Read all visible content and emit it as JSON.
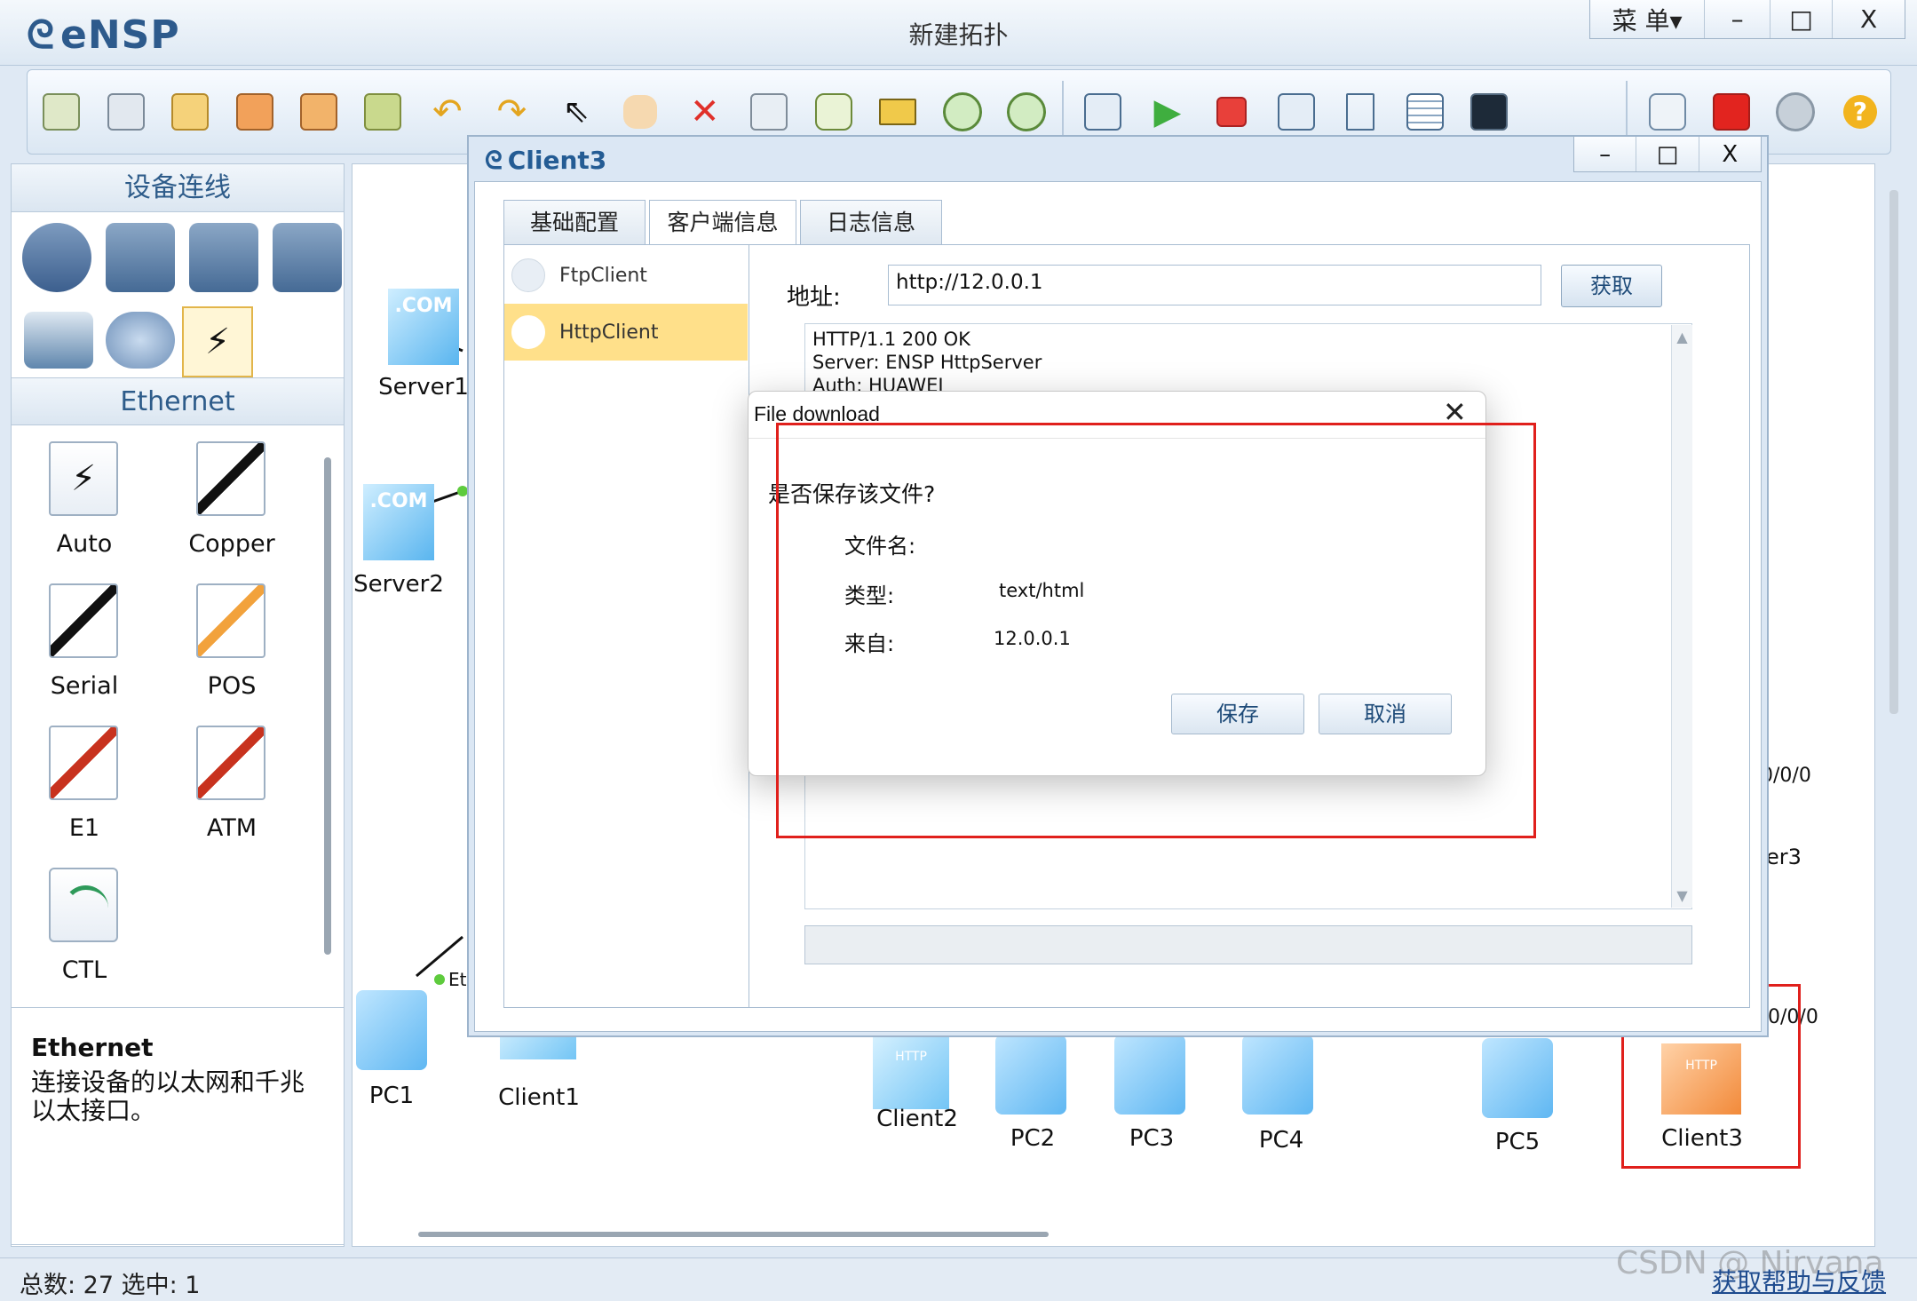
{
  "app": {
    "name": "eNSP",
    "window_title": "新建拓扑",
    "menu_label": "菜 单▾",
    "minimize": "–",
    "maximize": "□",
    "close": "X"
  },
  "toolbar": {
    "icons": [
      "new-topology-icon",
      "new-example-icon",
      "open-icon",
      "save-icon",
      "save-as-icon",
      "print-icon",
      "undo-icon",
      "redo-icon",
      "select-icon",
      "hand-icon",
      "delete-icon",
      "delete-link-icon",
      "text-icon",
      "palette-icon",
      "zoom-in-icon",
      "zoom-out-icon",
      "fit-icon",
      "start-icon",
      "stop-icon",
      "capture-icon",
      "topology-icon",
      "grid-icon",
      "screenshot-icon",
      "chat-icon",
      "huawei-icon",
      "settings-icon",
      "help-icon"
    ]
  },
  "left_panel": {
    "device_header": "设备连线",
    "link_header": "Ethernet",
    "links": [
      {
        "label": "Auto"
      },
      {
        "label": "Copper"
      },
      {
        "label": "Serial"
      },
      {
        "label": "POS"
      },
      {
        "label": "E1"
      },
      {
        "label": "ATM"
      },
      {
        "label": "CTL"
      }
    ],
    "tip_title": "Ethernet",
    "tip_text": "连接设备的以太网和千兆以太接口。"
  },
  "canvas": {
    "nodes": {
      "server1": "Server1",
      "server2": "Server2",
      "pc1": "PC1",
      "client1": "Client1",
      "client2": "Client2",
      "pc2": "PC2",
      "pc3": "PC3",
      "pc4": "PC4",
      "pc5": "PC5",
      "client3": "Client3",
      "server3_partial": "er3",
      "port_a": "0/0/0",
      "port_b": "0/0/0",
      "port_c": "Et"
    }
  },
  "client3_dialog": {
    "title": "Client3",
    "tabs": [
      "基础配置",
      "客户端信息",
      "日志信息"
    ],
    "side_items": [
      "FtpClient",
      "HttpClient"
    ],
    "address_label": "地址:",
    "address_value": "http://12.0.0.1",
    "fetch_button": "获取",
    "response_lines": [
      "HTTP/1.1 200 OK",
      "Server: ENSP HttpServer",
      "Auth: HUAWEI"
    ]
  },
  "file_download": {
    "title": "File download",
    "question": "是否保存该文件?",
    "filename_label": "文件名:",
    "filename_value": "",
    "type_label": "类型:",
    "type_value": "text/html",
    "from_label": "来自:",
    "from_value": "12.0.0.1",
    "save_button": "保存",
    "cancel_button": "取消"
  },
  "status": {
    "left": "总数: 27  选中: 1",
    "right": "获取帮助与反馈",
    "watermark": "CSDN @ Nirvana"
  },
  "colors": {
    "accent": "#2e5c8a",
    "annotation_red": "#e0201c",
    "selected_item": "#ffe08a"
  }
}
